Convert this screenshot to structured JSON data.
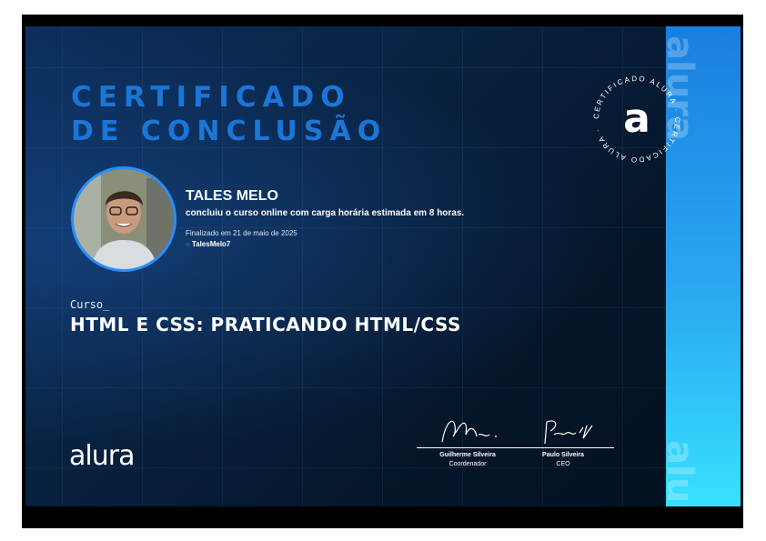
{
  "certificate": {
    "title_line1": "CERTIFICADO",
    "title_line2": "DE CONCLUSÃO",
    "seal_text": "CERTIFICADO ALURA · CERTIFICADO ALURA ·",
    "seal_letter": "a",
    "side_word": "alura"
  },
  "student": {
    "name": "TALES MELO",
    "summary": "concluiu o curso online com carga horária estimada em 8 horas.",
    "finished": "Finalizado em 21 de maio de 2025",
    "username": "TalesMelo7"
  },
  "course": {
    "label": "Curso_",
    "title": "HTML E CSS: PRATICANDO HTML/CSS"
  },
  "brand": {
    "logo": "alura"
  },
  "signatures": [
    {
      "name": "Guilherme Silveira",
      "role": "Coordenador"
    },
    {
      "name": "Paulo Silveira",
      "role": "CEO"
    }
  ],
  "colors": {
    "accent": "#1b76d6",
    "sidebar_top": "#1a7fe0",
    "sidebar_bottom": "#38e0ff",
    "background": "#061a33"
  },
  "icons": {
    "user_icon": "circle-icon"
  }
}
